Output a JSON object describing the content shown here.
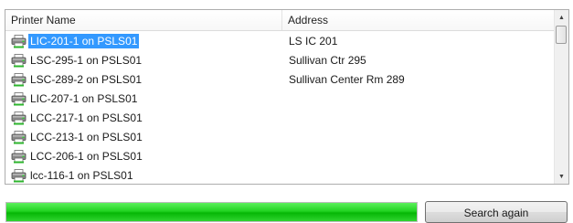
{
  "columns": {
    "name": "Printer Name",
    "address": "Address"
  },
  "printers": [
    {
      "name": "LIC-201-1 on PSLS01",
      "address": "LS IC 201",
      "selected": true
    },
    {
      "name": "LSC-295-1 on PSLS01",
      "address": "Sullivan Ctr 295",
      "selected": false
    },
    {
      "name": "LSC-289-2 on PSLS01",
      "address": "Sullivan Center Rm 289",
      "selected": false
    },
    {
      "name": "LIC-207-1 on PSLS01",
      "address": "",
      "selected": false
    },
    {
      "name": "LCC-217-1 on PSLS01",
      "address": "",
      "selected": false
    },
    {
      "name": "LCC-213-1 on PSLS01",
      "address": "",
      "selected": false
    },
    {
      "name": "LCC-206-1 on PSLS01",
      "address": "",
      "selected": false
    },
    {
      "name": "lcc-116-1 on PSLS01",
      "address": "",
      "selected": false
    }
  ],
  "row_icon": "printer-icon",
  "progress": {
    "fraction": 1.0,
    "color": "#06b706"
  },
  "search_button": {
    "label": "Search again"
  },
  "colors": {
    "selection": "#3399ff"
  }
}
